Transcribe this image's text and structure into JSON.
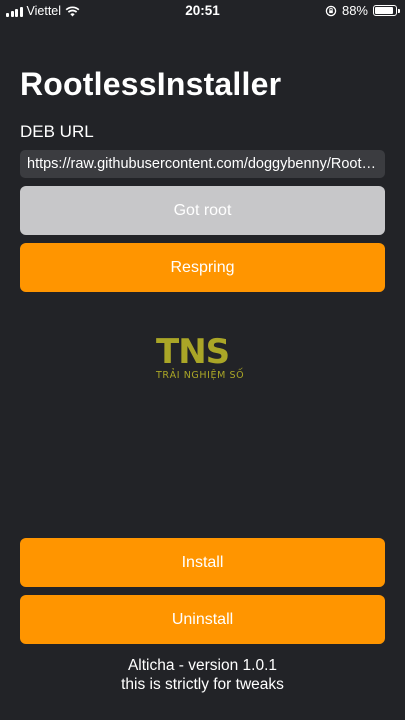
{
  "status_bar": {
    "carrier": "Viettel",
    "time": "20:51",
    "battery": "88%",
    "battery_level": 0.88,
    "icons": [
      "signal-bars-icon",
      "wifi-icon",
      "orientation-lock-icon",
      "battery-icon"
    ]
  },
  "app": {
    "title": "RootlessInstaller",
    "deb_label": "DEB URL",
    "deb_url": "https://raw.githubusercontent.com/doggybenny/RootL...",
    "got_root_label": "Got root",
    "respring_label": "Respring",
    "install_label": "Install",
    "uninstall_label": "Uninstall"
  },
  "watermark": {
    "letters": "TNS",
    "subtitle": "TRẢI NGHIỆM SỐ"
  },
  "footer": {
    "version": "Alticha - version 1.0.1",
    "note": "this is strictly for tweaks"
  },
  "colors": {
    "background": "#222327",
    "accent": "#ff9500",
    "disabled": "#c7c7c9",
    "field": "#3b3c40"
  }
}
